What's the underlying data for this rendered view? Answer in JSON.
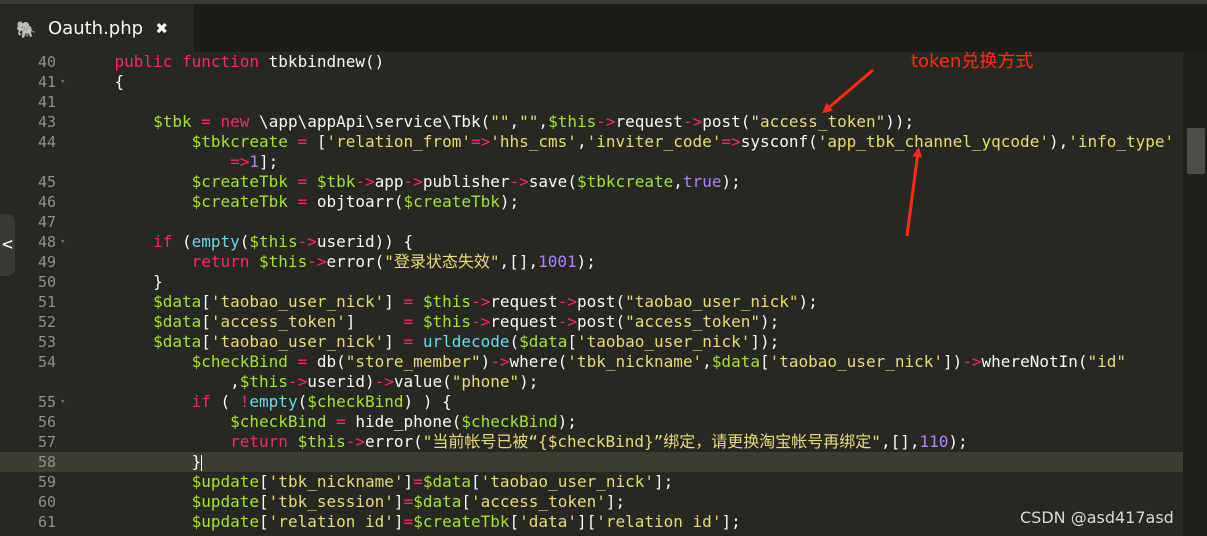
{
  "tab": {
    "icon": "php-elephant-icon",
    "title": "Oauth.php",
    "close_glyph": "✖"
  },
  "editor": {
    "current_line": "58",
    "lines": [
      {
        "num": "40",
        "fold": false,
        "tokens": [
          {
            "t": "    ",
            "c": ""
          },
          {
            "t": "public function",
            "c": "kw"
          },
          {
            "t": " tbkbindnew()",
            "c": ""
          }
        ]
      },
      {
        "num": "41",
        "fold": true,
        "tokens": [
          {
            "t": "    {",
            "c": ""
          }
        ]
      },
      {
        "num": "41",
        "fold": false,
        "tokens": []
      },
      {
        "num": "43",
        "fold": false,
        "tokens": [
          {
            "t": "        ",
            "c": ""
          },
          {
            "t": "$tbk",
            "c": "var"
          },
          {
            "t": " ",
            "c": ""
          },
          {
            "t": "=",
            "c": "op"
          },
          {
            "t": " ",
            "c": ""
          },
          {
            "t": "new",
            "c": "kw"
          },
          {
            "t": " \\app\\appApi\\service\\Tbk(",
            "c": ""
          },
          {
            "t": "\"\"",
            "c": "str"
          },
          {
            "t": ",",
            "c": ""
          },
          {
            "t": "\"\"",
            "c": "str"
          },
          {
            "t": ",",
            "c": ""
          },
          {
            "t": "$this",
            "c": "var"
          },
          {
            "t": "->",
            "c": "op"
          },
          {
            "t": "request",
            "c": ""
          },
          {
            "t": "->",
            "c": "op"
          },
          {
            "t": "post(",
            "c": ""
          },
          {
            "t": "\"access_token\"",
            "c": "str"
          },
          {
            "t": "));",
            "c": ""
          }
        ]
      },
      {
        "num": "44",
        "fold": false,
        "tokens": [
          {
            "t": "            ",
            "c": ""
          },
          {
            "t": "$tbkcreate",
            "c": "var"
          },
          {
            "t": " ",
            "c": ""
          },
          {
            "t": "=",
            "c": "op"
          },
          {
            "t": " [",
            "c": ""
          },
          {
            "t": "'relation_from'",
            "c": "str"
          },
          {
            "t": "=>",
            "c": "op"
          },
          {
            "t": "'hhs_cms'",
            "c": "str"
          },
          {
            "t": ",",
            "c": ""
          },
          {
            "t": "'inviter_code'",
            "c": "str"
          },
          {
            "t": "=>",
            "c": "op"
          },
          {
            "t": "sysconf(",
            "c": ""
          },
          {
            "t": "'app_tbk_channel_yqcode'",
            "c": "str"
          },
          {
            "t": "),",
            "c": ""
          },
          {
            "t": "'info_type'",
            "c": "str"
          }
        ]
      },
      {
        "num": "",
        "fold": false,
        "tokens": [
          {
            "t": "                ",
            "c": ""
          },
          {
            "t": "=>",
            "c": "op"
          },
          {
            "t": "1",
            "c": "num"
          },
          {
            "t": "];",
            "c": ""
          }
        ]
      },
      {
        "num": "45",
        "fold": false,
        "tokens": [
          {
            "t": "            ",
            "c": ""
          },
          {
            "t": "$createTbk",
            "c": "var"
          },
          {
            "t": " ",
            "c": ""
          },
          {
            "t": "=",
            "c": "op"
          },
          {
            "t": " ",
            "c": ""
          },
          {
            "t": "$tbk",
            "c": "var"
          },
          {
            "t": "->",
            "c": "op"
          },
          {
            "t": "app",
            "c": ""
          },
          {
            "t": "->",
            "c": "op"
          },
          {
            "t": "publisher",
            "c": ""
          },
          {
            "t": "->",
            "c": "op"
          },
          {
            "t": "save(",
            "c": ""
          },
          {
            "t": "$tbkcreate",
            "c": "var"
          },
          {
            "t": ",",
            "c": ""
          },
          {
            "t": "true",
            "c": "num"
          },
          {
            "t": ");",
            "c": ""
          }
        ]
      },
      {
        "num": "46",
        "fold": false,
        "tokens": [
          {
            "t": "            ",
            "c": ""
          },
          {
            "t": "$createTbk",
            "c": "var"
          },
          {
            "t": " ",
            "c": ""
          },
          {
            "t": "=",
            "c": "op"
          },
          {
            "t": " objtoarr(",
            "c": ""
          },
          {
            "t": "$createTbk",
            "c": "var"
          },
          {
            "t": ");",
            "c": ""
          }
        ]
      },
      {
        "num": "47",
        "fold": false,
        "tokens": []
      },
      {
        "num": "48",
        "fold": true,
        "tokens": [
          {
            "t": "        ",
            "c": ""
          },
          {
            "t": "if",
            "c": "kw"
          },
          {
            "t": " (",
            "c": ""
          },
          {
            "t": "empty",
            "c": "fn"
          },
          {
            "t": "(",
            "c": ""
          },
          {
            "t": "$this",
            "c": "var"
          },
          {
            "t": "->",
            "c": "op"
          },
          {
            "t": "userid)) {",
            "c": ""
          }
        ]
      },
      {
        "num": "49",
        "fold": false,
        "tokens": [
          {
            "t": "            ",
            "c": ""
          },
          {
            "t": "return",
            "c": "kw"
          },
          {
            "t": " ",
            "c": ""
          },
          {
            "t": "$this",
            "c": "var"
          },
          {
            "t": "->",
            "c": "op"
          },
          {
            "t": "error(",
            "c": ""
          },
          {
            "t": "\"登录状态失效\"",
            "c": "str"
          },
          {
            "t": ",[],",
            "c": ""
          },
          {
            "t": "1001",
            "c": "num"
          },
          {
            "t": ");",
            "c": ""
          }
        ]
      },
      {
        "num": "50",
        "fold": false,
        "tokens": [
          {
            "t": "        }",
            "c": ""
          }
        ]
      },
      {
        "num": "51",
        "fold": false,
        "tokens": [
          {
            "t": "        ",
            "c": ""
          },
          {
            "t": "$data",
            "c": "var"
          },
          {
            "t": "[",
            "c": ""
          },
          {
            "t": "'taobao_user_nick'",
            "c": "str"
          },
          {
            "t": "] ",
            "c": ""
          },
          {
            "t": "=",
            "c": "op"
          },
          {
            "t": " ",
            "c": ""
          },
          {
            "t": "$this",
            "c": "var"
          },
          {
            "t": "->",
            "c": "op"
          },
          {
            "t": "request",
            "c": ""
          },
          {
            "t": "->",
            "c": "op"
          },
          {
            "t": "post(",
            "c": ""
          },
          {
            "t": "\"taobao_user_nick\"",
            "c": "str"
          },
          {
            "t": ");",
            "c": ""
          }
        ]
      },
      {
        "num": "52",
        "fold": false,
        "tokens": [
          {
            "t": "        ",
            "c": ""
          },
          {
            "t": "$data",
            "c": "var"
          },
          {
            "t": "[",
            "c": ""
          },
          {
            "t": "'access_token'",
            "c": "str"
          },
          {
            "t": "]     ",
            "c": ""
          },
          {
            "t": "=",
            "c": "op"
          },
          {
            "t": " ",
            "c": ""
          },
          {
            "t": "$this",
            "c": "var"
          },
          {
            "t": "->",
            "c": "op"
          },
          {
            "t": "request",
            "c": ""
          },
          {
            "t": "->",
            "c": "op"
          },
          {
            "t": "post(",
            "c": ""
          },
          {
            "t": "\"access_token\"",
            "c": "str"
          },
          {
            "t": ");",
            "c": ""
          }
        ]
      },
      {
        "num": "53",
        "fold": false,
        "tokens": [
          {
            "t": "        ",
            "c": ""
          },
          {
            "t": "$data",
            "c": "var"
          },
          {
            "t": "[",
            "c": ""
          },
          {
            "t": "'taobao_user_nick'",
            "c": "str"
          },
          {
            "t": "] ",
            "c": ""
          },
          {
            "t": "=",
            "c": "op"
          },
          {
            "t": " ",
            "c": ""
          },
          {
            "t": "urldecode",
            "c": "fn"
          },
          {
            "t": "(",
            "c": ""
          },
          {
            "t": "$data",
            "c": "var"
          },
          {
            "t": "[",
            "c": ""
          },
          {
            "t": "'taobao_user_nick'",
            "c": "str"
          },
          {
            "t": "]);",
            "c": ""
          }
        ]
      },
      {
        "num": "54",
        "fold": false,
        "tokens": [
          {
            "t": "            ",
            "c": ""
          },
          {
            "t": "$checkBind",
            "c": "var"
          },
          {
            "t": " ",
            "c": ""
          },
          {
            "t": "=",
            "c": "op"
          },
          {
            "t": " db(",
            "c": ""
          },
          {
            "t": "\"store_member\"",
            "c": "str"
          },
          {
            "t": ")",
            "c": ""
          },
          {
            "t": "->",
            "c": "op"
          },
          {
            "t": "where(",
            "c": ""
          },
          {
            "t": "'tbk_nickname'",
            "c": "str"
          },
          {
            "t": ",",
            "c": ""
          },
          {
            "t": "$data",
            "c": "var"
          },
          {
            "t": "[",
            "c": ""
          },
          {
            "t": "'taobao_user_nick'",
            "c": "str"
          },
          {
            "t": "])",
            "c": ""
          },
          {
            "t": "->",
            "c": "op"
          },
          {
            "t": "whereNotIn(",
            "c": ""
          },
          {
            "t": "\"id\"",
            "c": "str"
          }
        ]
      },
      {
        "num": "",
        "fold": false,
        "tokens": [
          {
            "t": "                ,",
            "c": ""
          },
          {
            "t": "$this",
            "c": "var"
          },
          {
            "t": "->",
            "c": "op"
          },
          {
            "t": "userid)",
            "c": ""
          },
          {
            "t": "->",
            "c": "op"
          },
          {
            "t": "value(",
            "c": ""
          },
          {
            "t": "\"phone\"",
            "c": "str"
          },
          {
            "t": ");",
            "c": ""
          }
        ]
      },
      {
        "num": "55",
        "fold": true,
        "tokens": [
          {
            "t": "            ",
            "c": ""
          },
          {
            "t": "if",
            "c": "kw"
          },
          {
            "t": " ( ",
            "c": ""
          },
          {
            "t": "!",
            "c": "op"
          },
          {
            "t": "empty",
            "c": "fn"
          },
          {
            "t": "(",
            "c": ""
          },
          {
            "t": "$checkBind",
            "c": "var"
          },
          {
            "t": ") ) {",
            "c": ""
          }
        ]
      },
      {
        "num": "56",
        "fold": false,
        "tokens": [
          {
            "t": "                ",
            "c": ""
          },
          {
            "t": "$checkBind",
            "c": "var"
          },
          {
            "t": " ",
            "c": ""
          },
          {
            "t": "=",
            "c": "op"
          },
          {
            "t": " hide_phone(",
            "c": ""
          },
          {
            "t": "$checkBind",
            "c": "var"
          },
          {
            "t": ");",
            "c": ""
          }
        ]
      },
      {
        "num": "57",
        "fold": false,
        "tokens": [
          {
            "t": "                ",
            "c": ""
          },
          {
            "t": "return",
            "c": "kw"
          },
          {
            "t": " ",
            "c": ""
          },
          {
            "t": "$this",
            "c": "var"
          },
          {
            "t": "->",
            "c": "op"
          },
          {
            "t": "error(",
            "c": ""
          },
          {
            "t": "\"当前帐号已被“{$checkBind}”绑定，请更换淘宝帐号再绑定\"",
            "c": "str"
          },
          {
            "t": ",[],",
            "c": ""
          },
          {
            "t": "110",
            "c": "num"
          },
          {
            "t": ");",
            "c": ""
          }
        ]
      },
      {
        "num": "58",
        "fold": false,
        "cursor": true,
        "tokens": [
          {
            "t": "            }",
            "c": ""
          }
        ]
      },
      {
        "num": "59",
        "fold": false,
        "tokens": [
          {
            "t": "            ",
            "c": ""
          },
          {
            "t": "$update",
            "c": "var"
          },
          {
            "t": "[",
            "c": ""
          },
          {
            "t": "'tbk_nickname'",
            "c": "str"
          },
          {
            "t": "]",
            "c": ""
          },
          {
            "t": "=",
            "c": "op"
          },
          {
            "t": "$data",
            "c": "var"
          },
          {
            "t": "[",
            "c": ""
          },
          {
            "t": "'taobao_user_nick'",
            "c": "str"
          },
          {
            "t": "];",
            "c": ""
          }
        ]
      },
      {
        "num": "60",
        "fold": false,
        "tokens": [
          {
            "t": "            ",
            "c": ""
          },
          {
            "t": "$update",
            "c": "var"
          },
          {
            "t": "[",
            "c": ""
          },
          {
            "t": "'tbk_session'",
            "c": "str"
          },
          {
            "t": "]",
            "c": ""
          },
          {
            "t": "=",
            "c": "op"
          },
          {
            "t": "$data",
            "c": "var"
          },
          {
            "t": "[",
            "c": ""
          },
          {
            "t": "'access_token'",
            "c": "str"
          },
          {
            "t": "];",
            "c": ""
          }
        ]
      },
      {
        "num": "61",
        "fold": false,
        "tokens": [
          {
            "t": "            ",
            "c": ""
          },
          {
            "t": "$update",
            "c": "var"
          },
          {
            "t": "[",
            "c": ""
          },
          {
            "t": "'relation id'",
            "c": "str"
          },
          {
            "t": "]",
            "c": ""
          },
          {
            "t": "=",
            "c": "op"
          },
          {
            "t": "$createTbk",
            "c": "var"
          },
          {
            "t": "[",
            "c": ""
          },
          {
            "t": "'data'",
            "c": "str"
          },
          {
            "t": "][",
            "c": ""
          },
          {
            "t": "'relation id'",
            "c": "str"
          },
          {
            "t": "];",
            "c": ""
          }
        ]
      }
    ]
  },
  "annotation": {
    "text": "token兑换方式",
    "color": "#ff2a1a"
  },
  "side_handle": {
    "glyph": "<"
  },
  "watermark": "CSDN @asd417asd",
  "colors": {
    "background": "#272822",
    "keyword": "#f92672",
    "variable": "#a6e22e",
    "string": "#e6db74",
    "number": "#ae81ff",
    "function": "#66d9ef"
  }
}
